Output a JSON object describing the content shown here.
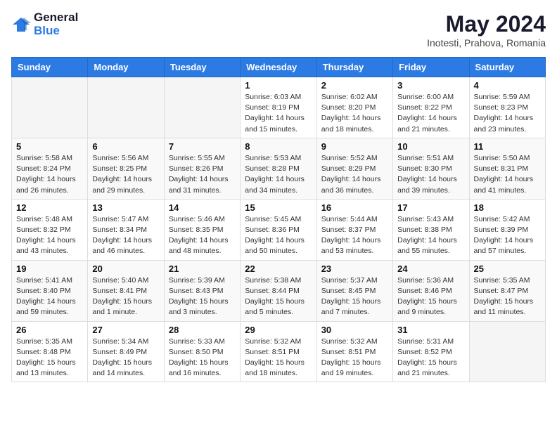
{
  "logo": {
    "line1": "General",
    "line2": "Blue"
  },
  "title": "May 2024",
  "subtitle": "Inotesti, Prahova, Romania",
  "weekdays": [
    "Sunday",
    "Monday",
    "Tuesday",
    "Wednesday",
    "Thursday",
    "Friday",
    "Saturday"
  ],
  "weeks": [
    [
      {
        "day": "",
        "info": ""
      },
      {
        "day": "",
        "info": ""
      },
      {
        "day": "",
        "info": ""
      },
      {
        "day": "1",
        "info": "Sunrise: 6:03 AM\nSunset: 8:19 PM\nDaylight: 14 hours\nand 15 minutes."
      },
      {
        "day": "2",
        "info": "Sunrise: 6:02 AM\nSunset: 8:20 PM\nDaylight: 14 hours\nand 18 minutes."
      },
      {
        "day": "3",
        "info": "Sunrise: 6:00 AM\nSunset: 8:22 PM\nDaylight: 14 hours\nand 21 minutes."
      },
      {
        "day": "4",
        "info": "Sunrise: 5:59 AM\nSunset: 8:23 PM\nDaylight: 14 hours\nand 23 minutes."
      }
    ],
    [
      {
        "day": "5",
        "info": "Sunrise: 5:58 AM\nSunset: 8:24 PM\nDaylight: 14 hours\nand 26 minutes."
      },
      {
        "day": "6",
        "info": "Sunrise: 5:56 AM\nSunset: 8:25 PM\nDaylight: 14 hours\nand 29 minutes."
      },
      {
        "day": "7",
        "info": "Sunrise: 5:55 AM\nSunset: 8:26 PM\nDaylight: 14 hours\nand 31 minutes."
      },
      {
        "day": "8",
        "info": "Sunrise: 5:53 AM\nSunset: 8:28 PM\nDaylight: 14 hours\nand 34 minutes."
      },
      {
        "day": "9",
        "info": "Sunrise: 5:52 AM\nSunset: 8:29 PM\nDaylight: 14 hours\nand 36 minutes."
      },
      {
        "day": "10",
        "info": "Sunrise: 5:51 AM\nSunset: 8:30 PM\nDaylight: 14 hours\nand 39 minutes."
      },
      {
        "day": "11",
        "info": "Sunrise: 5:50 AM\nSunset: 8:31 PM\nDaylight: 14 hours\nand 41 minutes."
      }
    ],
    [
      {
        "day": "12",
        "info": "Sunrise: 5:48 AM\nSunset: 8:32 PM\nDaylight: 14 hours\nand 43 minutes."
      },
      {
        "day": "13",
        "info": "Sunrise: 5:47 AM\nSunset: 8:34 PM\nDaylight: 14 hours\nand 46 minutes."
      },
      {
        "day": "14",
        "info": "Sunrise: 5:46 AM\nSunset: 8:35 PM\nDaylight: 14 hours\nand 48 minutes."
      },
      {
        "day": "15",
        "info": "Sunrise: 5:45 AM\nSunset: 8:36 PM\nDaylight: 14 hours\nand 50 minutes."
      },
      {
        "day": "16",
        "info": "Sunrise: 5:44 AM\nSunset: 8:37 PM\nDaylight: 14 hours\nand 53 minutes."
      },
      {
        "day": "17",
        "info": "Sunrise: 5:43 AM\nSunset: 8:38 PM\nDaylight: 14 hours\nand 55 minutes."
      },
      {
        "day": "18",
        "info": "Sunrise: 5:42 AM\nSunset: 8:39 PM\nDaylight: 14 hours\nand 57 minutes."
      }
    ],
    [
      {
        "day": "19",
        "info": "Sunrise: 5:41 AM\nSunset: 8:40 PM\nDaylight: 14 hours\nand 59 minutes."
      },
      {
        "day": "20",
        "info": "Sunrise: 5:40 AM\nSunset: 8:41 PM\nDaylight: 15 hours\nand 1 minute."
      },
      {
        "day": "21",
        "info": "Sunrise: 5:39 AM\nSunset: 8:43 PM\nDaylight: 15 hours\nand 3 minutes."
      },
      {
        "day": "22",
        "info": "Sunrise: 5:38 AM\nSunset: 8:44 PM\nDaylight: 15 hours\nand 5 minutes."
      },
      {
        "day": "23",
        "info": "Sunrise: 5:37 AM\nSunset: 8:45 PM\nDaylight: 15 hours\nand 7 minutes."
      },
      {
        "day": "24",
        "info": "Sunrise: 5:36 AM\nSunset: 8:46 PM\nDaylight: 15 hours\nand 9 minutes."
      },
      {
        "day": "25",
        "info": "Sunrise: 5:35 AM\nSunset: 8:47 PM\nDaylight: 15 hours\nand 11 minutes."
      }
    ],
    [
      {
        "day": "26",
        "info": "Sunrise: 5:35 AM\nSunset: 8:48 PM\nDaylight: 15 hours\nand 13 minutes."
      },
      {
        "day": "27",
        "info": "Sunrise: 5:34 AM\nSunset: 8:49 PM\nDaylight: 15 hours\nand 14 minutes."
      },
      {
        "day": "28",
        "info": "Sunrise: 5:33 AM\nSunset: 8:50 PM\nDaylight: 15 hours\nand 16 minutes."
      },
      {
        "day": "29",
        "info": "Sunrise: 5:32 AM\nSunset: 8:51 PM\nDaylight: 15 hours\nand 18 minutes."
      },
      {
        "day": "30",
        "info": "Sunrise: 5:32 AM\nSunset: 8:51 PM\nDaylight: 15 hours\nand 19 minutes."
      },
      {
        "day": "31",
        "info": "Sunrise: 5:31 AM\nSunset: 8:52 PM\nDaylight: 15 hours\nand 21 minutes."
      },
      {
        "day": "",
        "info": ""
      }
    ]
  ]
}
